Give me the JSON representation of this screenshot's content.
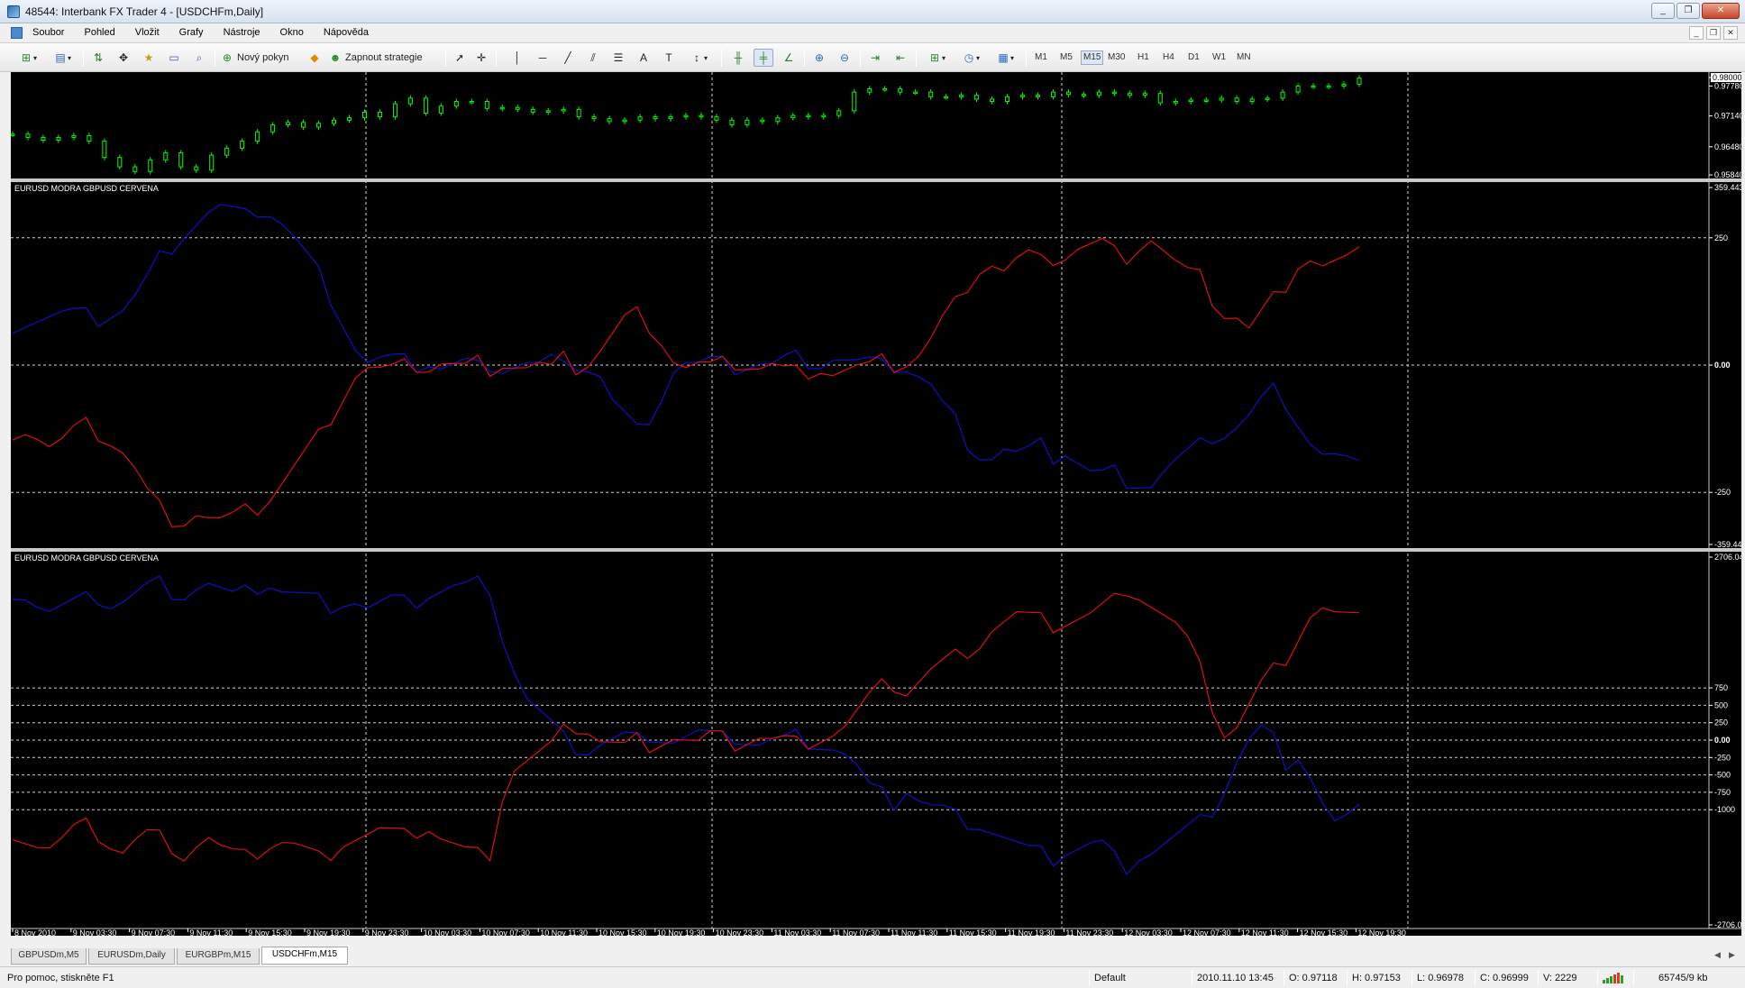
{
  "window": {
    "title": "48544: Interbank FX Trader 4 - [USDCHFm,Daily]",
    "buttons": {
      "minimize": "_",
      "restore": "❐",
      "close": "✕"
    },
    "mdi_buttons": {
      "minimize": "_",
      "restore": "❐",
      "close": "✕"
    }
  },
  "menu": [
    "Soubor",
    "Pohled",
    "Vložit",
    "Grafy",
    "Nástroje",
    "Okno",
    "Nápověda"
  ],
  "toolbar": {
    "new_order": "Nový pokyn",
    "expert": "Zapnout strategie",
    "timeframes": [
      "M1",
      "M5",
      "M15",
      "M30",
      "H1",
      "H4",
      "D1",
      "W1",
      "MN"
    ],
    "active_timeframe": "M15"
  },
  "colors": {
    "chart_bg": "#000000",
    "candles": "#00ff00",
    "series_blue": "#1010c8",
    "series_red": "#dd1010",
    "grid": "#cfcfcf",
    "axis_text": "#ffffff"
  },
  "tabs": {
    "items": [
      "GBPUSDm,M5",
      "EURUSDm,Daily",
      "EURGBPm,M15",
      "USDCHFm,M15"
    ],
    "active": "USDCHFm,M15"
  },
  "status": {
    "help": "Pro pomoc, stiskněte F1",
    "profile": "Default",
    "time": "2010.11.10 13:45",
    "open": "O: 0.97118",
    "high": "H: 0.97153",
    "low": "L: 0.96978",
    "close": "C: 0.96999",
    "volume": "V: 2229",
    "traffic": "65745/9 kb"
  },
  "chart_data": [
    {
      "type": "line",
      "pane": "price",
      "symbol": "USDCHFm",
      "series": [
        {
          "values": [
            0.9675,
            0.9668,
            0.9662,
            0.9668,
            0.9672,
            0.966,
            0.9625,
            0.9605,
            0.9595,
            0.962,
            0.9635,
            0.9605,
            0.9598,
            0.963,
            0.9645,
            0.966,
            0.968,
            0.9695,
            0.97,
            0.969,
            0.9698,
            0.9705,
            0.971,
            0.9722,
            0.9712,
            0.974,
            0.9752,
            0.972,
            0.9735,
            0.9745,
            0.9745,
            0.973,
            0.9732,
            0.9728,
            0.9722,
            0.9725,
            0.9728,
            0.9712,
            0.9708,
            0.9702,
            0.9705,
            0.9712,
            0.9708,
            0.9712,
            0.9715,
            0.9712,
            0.9705,
            0.9695,
            0.9705,
            0.9702,
            0.971,
            0.9715,
            0.9712,
            0.9715,
            0.9725,
            0.9765,
            0.9772,
            0.9772,
            0.9765,
            0.9765,
            0.9755,
            0.9755,
            0.9758,
            0.975,
            0.9745,
            0.9755,
            0.9758,
            0.9755,
            0.9765,
            0.976,
            0.9758,
            0.9765,
            0.9762,
            0.9758,
            0.9762,
            0.9742,
            0.9745,
            0.9748,
            0.9748,
            0.9752,
            0.9745,
            0.975,
            0.9752,
            0.9765,
            0.9778,
            0.9778,
            0.9778,
            0.9782,
            0.9795
          ]
        }
      ],
      "ylim": [
        0.9584,
        0.98
      ],
      "y_ticks": [
        "0.98000",
        "0.97780",
        "0.97140",
        "0.96480",
        "0.95840"
      ]
    },
    {
      "type": "line",
      "pane": "indicator-1",
      "label": "EURUSD MODRA   GBPUSD CERVENA",
      "series": [
        {
          "name": "EURUSD MODRA",
          "color": "#1010c8",
          "values": [
            80,
            85,
            90,
            95,
            100,
            100,
            95,
            90,
            100,
            110,
            135,
            170,
            210,
            235,
            260,
            280,
            300,
            310,
            300,
            290,
            305,
            300,
            280,
            250,
            215,
            180,
            135,
            85,
            35,
            5,
            10,
            10,
            5,
            0,
            5,
            -5,
            0,
            5,
            -5,
            5,
            -5,
            0,
            5,
            0,
            10,
            -10,
            5,
            -5,
            -20,
            -70,
            -100,
            -130,
            -100,
            -60,
            -10,
            5,
            0,
            5,
            0,
            -5,
            0,
            5,
            0,
            10,
            15,
            10,
            5,
            15,
            10,
            5,
            5,
            -5,
            0,
            -5,
            -20,
            -40,
            -80,
            -110,
            -150,
            -175,
            -180,
            -165,
            -175,
            -170,
            -160,
            -180,
            -170,
            -190,
            -210,
            -215,
            -210,
            -225,
            -230,
            -235,
            -210,
            -190,
            -175,
            -160,
            -140,
            -135,
            -120,
            -100,
            -70,
            -50,
            -70,
            -110,
            -150,
            -175,
            -180,
            -190,
            -205
          ]
        },
        {
          "name": "GBPUSD CERVENA",
          "color": "#dd1010",
          "values": [
            -130,
            -125,
            -140,
            -160,
            -150,
            -130,
            -120,
            -135,
            -150,
            -170,
            -205,
            -250,
            -280,
            -300,
            -305,
            -290,
            -300,
            -305,
            -300,
            -290,
            -280,
            -260,
            -230,
            -200,
            -170,
            -140,
            -100,
            -60,
            -20,
            -5,
            -10,
            -10,
            -5,
            0,
            -5,
            5,
            0,
            -5,
            5,
            -5,
            5,
            0,
            -5,
            0,
            -10,
            10,
            -5,
            5,
            30,
            60,
            90,
            100,
            80,
            50,
            10,
            -5,
            0,
            -5,
            0,
            5,
            0,
            -5,
            0,
            -10,
            -15,
            -10,
            -5,
            -15,
            -10,
            -5,
            -5,
            5,
            0,
            5,
            20,
            50,
            90,
            120,
            160,
            190,
            200,
            185,
            205,
            215,
            200,
            210,
            215,
            230,
            235,
            240,
            220,
            215,
            235,
            250,
            225,
            200,
            180,
            170,
            130,
            100,
            95,
            70,
            100,
            130,
            160,
            200,
            210,
            195,
            200,
            205,
            215
          ]
        }
      ],
      "ylim": [
        -359.443,
        359.4434
      ],
      "y_ticks": [
        "359.4434",
        "250",
        "0.00",
        "-250",
        "-359.443"
      ]
    },
    {
      "type": "line",
      "pane": "indicator-2",
      "label": "EURUSD MODRA   GBPUSD CERVENA",
      "series": [
        {
          "name": "EURUSD MODRA",
          "color": "#1010c8",
          "values": [
            2150,
            2100,
            1950,
            1850,
            1900,
            1950,
            2000,
            2050,
            1950,
            2000,
            2100,
            2200,
            2250,
            2150,
            2100,
            2200,
            2250,
            2150,
            2050,
            2100,
            2200,
            2250,
            2150,
            2100,
            2050,
            2000,
            1950,
            2000,
            2000,
            1900,
            1950,
            2000,
            1950,
            2000,
            2100,
            2150,
            2200,
            2200,
            2250,
            2200,
            1500,
            1000,
            600,
            400,
            200,
            0,
            -100,
            -150,
            -50,
            0,
            50,
            0,
            100,
            50,
            0,
            50,
            100,
            50,
            0,
            50,
            0,
            -50,
            0,
            0,
            50,
            0,
            -50,
            -100,
            -200,
            -400,
            -700,
            -800,
            -900,
            -700,
            -850,
            -950,
            -1000,
            -1100,
            -1150,
            -1200,
            -1300,
            -1400,
            -1500,
            -1600,
            -1650,
            -1700,
            -1600,
            -1550,
            -1500,
            -1500,
            -1700,
            -1800,
            -1650,
            -1600,
            -1500,
            -1400,
            -1300,
            -1200,
            -1000,
            -700,
            -300,
            0,
            150,
            0,
            -300,
            -200,
            -500,
            -900,
            -1200,
            -1150,
            -1050
          ]
        },
        {
          "name": "GBPUSD CERVENA",
          "color": "#dd1010",
          "values": [
            -1300,
            -1400,
            -1500,
            -1550,
            -1450,
            -1300,
            -1250,
            -1350,
            -1500,
            -1600,
            -1450,
            -1350,
            -1400,
            -1500,
            -1650,
            -1500,
            -1400,
            -1550,
            -1650,
            -1700,
            -1600,
            -1500,
            -1450,
            -1500,
            -1600,
            -1700,
            -1600,
            -1450,
            -1400,
            -1350,
            -1300,
            -1350,
            -1400,
            -1300,
            -1250,
            -1400,
            -1500,
            -1600,
            -1650,
            -1600,
            -800,
            -400,
            -300,
            -200,
            -100,
            100,
            200,
            150,
            0,
            -50,
            -100,
            0,
            -50,
            0,
            50,
            0,
            -50,
            50,
            0,
            -50,
            0,
            50,
            0,
            0,
            -50,
            0,
            50,
            100,
            200,
            400,
            600,
            750,
            800,
            700,
            850,
            1000,
            1100,
            1200,
            1300,
            1400,
            1600,
            1700,
            1800,
            1750,
            1700,
            1650,
            1700,
            1750,
            1800,
            1900,
            2000,
            2200,
            2100,
            1950,
            1800,
            1650,
            1400,
            1000,
            500,
            100,
            200,
            500,
            800,
            1000,
            1200,
            1500,
            1800,
            1900,
            1800,
            1750,
            1700
          ]
        }
      ],
      "ylim": [
        -2706.043,
        2706.043
      ],
      "y_ticks": [
        "2706.043",
        "750",
        "500",
        "250",
        "0.00",
        "-250",
        "-500",
        "-750",
        "-1000",
        "-2706.043"
      ]
    }
  ],
  "x_axis_labels": [
    "8 Nov 2010",
    "9 Nov 03:30",
    "9 Nov 07:30",
    "9 Nov 11:30",
    "9 Nov 15:30",
    "9 Nov 19:30",
    "9 Nov 23:30",
    "10 Nov 03:30",
    "10 Nov 07:30",
    "10 Nov 11:30",
    "10 Nov 15:30",
    "10 Nov 19:30",
    "10 Nov 23:30",
    "11 Nov 03:30",
    "11 Nov 07:30",
    "11 Nov 11:30",
    "11 Nov 15:30",
    "11 Nov 19:30",
    "11 Nov 23:30",
    "12 Nov 03:30",
    "12 Nov 07:30",
    "12 Nov 11:30",
    "12 Nov 15:30",
    "12 Nov 19:30"
  ]
}
